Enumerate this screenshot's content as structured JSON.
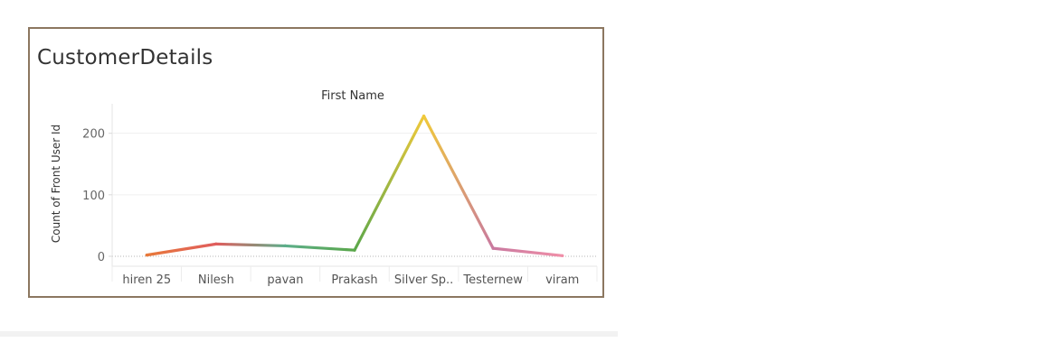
{
  "dashboard": {
    "sheet_title": "CustomerDetails"
  },
  "chart_data": {
    "type": "line",
    "title": "CustomerDetails",
    "column_header": "First Name",
    "ylabel": "Count of Front User Id",
    "xlabel": "",
    "categories": [
      "hiren 25",
      "Nilesh",
      "pavan",
      "Prakash",
      "Silver Sp..",
      "Testernew",
      "viram"
    ],
    "values": [
      2,
      20,
      17,
      10,
      228,
      13,
      1
    ],
    "yticks": [
      0,
      100,
      200
    ],
    "ylim": [
      0,
      245
    ],
    "grid": true,
    "legend": "none",
    "point_colors": [
      "#e8793a",
      "#e05d5d",
      "#5cae8a",
      "#5aa74a",
      "#f0c93a",
      "#c9799f",
      "#f08fa8"
    ]
  }
}
